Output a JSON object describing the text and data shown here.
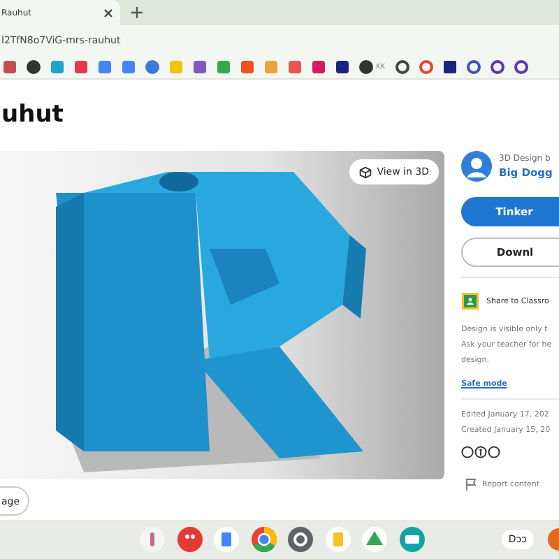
{
  "browser": {
    "tabs": [
      {
        "title": "Rauhut",
        "selected": true
      }
    ],
    "address": "l2TfN8o7ViG-mrs-rauhut",
    "bookmark_label": "KK"
  },
  "page": {
    "title": "uhut",
    "view_button": "View in 3D",
    "author_caption": "3D Design b",
    "author": "Big Dogg",
    "actions": [
      {
        "kind": "primary",
        "label": "Tinker"
      },
      {
        "kind": "outline",
        "label": "Downl"
      }
    ],
    "share": "Share to Classro",
    "notice": "Design is visible only t\nAsk your teacher for he\ndesign.",
    "safe_mode": "Safe mode",
    "edited": "Edited January 17, 202",
    "created": "Created January 15, 20",
    "report": "Report content",
    "bottom_button": "age"
  },
  "shelf": {
    "tray": "Dɔɔ"
  }
}
